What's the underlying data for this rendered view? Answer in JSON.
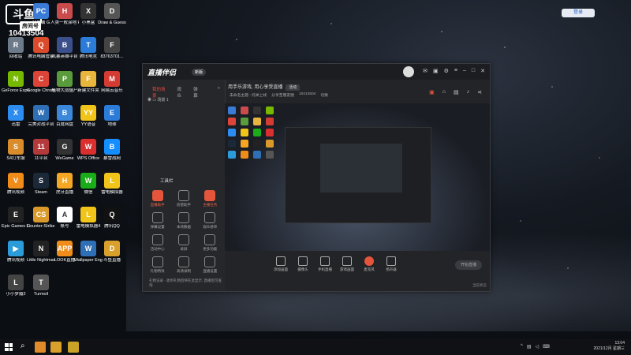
{
  "desktop": {
    "badge": {
      "logo_text": "斗鱼",
      "room_label": "房间号",
      "room_id": "10413504"
    },
    "top_right_button": "登录",
    "icons": [
      {
        "label": "此电脑 G",
        "color": "#3a7bd5",
        "glyph": "PC"
      },
      {
        "label": "人类一败涂地 Human Fa...",
        "color": "#c94b4b",
        "glyph": "H"
      },
      {
        "label": "小黑盒",
        "color": "#333",
        "glyph": "X"
      },
      {
        "label": "Draw & Guess",
        "color": "#555",
        "glyph": "D"
      },
      {
        "label": "回收站",
        "color": "#6c7a89",
        "glyph": "R"
      },
      {
        "label": "腾讯电脑管家",
        "color": "#d94b2b",
        "glyph": "Q"
      },
      {
        "label": "风暴英雄平台",
        "color": "#3b4f8a",
        "glyph": "B"
      },
      {
        "label": "腾讯电竞",
        "color": "#2b7bd9",
        "glyph": "T"
      },
      {
        "label": "83763701...",
        "color": "#444",
        "glyph": "F"
      },
      {
        "label": "GeForce Experience",
        "color": "#76b900",
        "glyph": "N"
      },
      {
        "label": "Google Chrome",
        "color": "#db4437",
        "glyph": "C"
      },
      {
        "label": "植物大战僵尸",
        "color": "#5a9c3b",
        "glyph": "P"
      },
      {
        "label": "新建文件夹",
        "color": "#e8b63c",
        "glyph": "F"
      },
      {
        "label": "网易云音乐",
        "color": "#d43c33",
        "glyph": "M"
      },
      {
        "label": "迅雷",
        "color": "#2d8cf0",
        "glyph": "X"
      },
      {
        "label": "完美对战平台",
        "color": "#2f6fb5",
        "glyph": "W"
      },
      {
        "label": "百度网盘",
        "color": "#3b87d9",
        "glyph": "B"
      },
      {
        "label": "YY语音",
        "color": "#f0c419",
        "glyph": "YY"
      },
      {
        "label": "地球",
        "color": "#2b7bd9",
        "glyph": "E"
      },
      {
        "label": "S4打车服",
        "color": "#d98c2b",
        "glyph": "S"
      },
      {
        "label": "11平台",
        "color": "#b33a3a",
        "glyph": "11"
      },
      {
        "label": "WeGame",
        "color": "#333",
        "glyph": "G"
      },
      {
        "label": "WPS Office",
        "color": "#d9302f",
        "glyph": "W"
      },
      {
        "label": "暴雪战网",
        "color": "#148eff",
        "glyph": "B"
      },
      {
        "label": "腾讯视频",
        "color": "#f08c1a",
        "glyph": "V"
      },
      {
        "label": "Steam",
        "color": "#1b2838",
        "glyph": "S"
      },
      {
        "label": "虎牙直播",
        "color": "#f5a623",
        "glyph": "H"
      },
      {
        "label": "微信",
        "color": "#1aad19",
        "glyph": "W"
      },
      {
        "label": "雷电模拟器",
        "color": "#f0c419",
        "glyph": "L"
      },
      {
        "label": "Epic Games Launcher",
        "color": "#222",
        "glyph": "E"
      },
      {
        "label": "Counter-Strike Global Off...",
        "color": "#d99a2b",
        "glyph": "CS"
      },
      {
        "label": "账号",
        "color": "#fff",
        "glyph": "A"
      },
      {
        "label": "雷电模拟器4",
        "color": "#f0c419",
        "glyph": "L"
      },
      {
        "label": "腾讯QQ",
        "color": "#111",
        "glyph": "Q"
      },
      {
        "label": "腾讯视频",
        "color": "#2b9cd9",
        "glyph": "▶"
      },
      {
        "label": "Little Nightmares",
        "color": "#222",
        "glyph": "N"
      },
      {
        "label": "LOOK直播",
        "color": "#f08c1a",
        "glyph": "APP"
      },
      {
        "label": "Wallpaper Engine",
        "color": "#2f6fb5",
        "glyph": "W"
      },
      {
        "label": "斗鱼直播",
        "color": "#d9a02b",
        "glyph": "D"
      },
      {
        "label": "小小梦魇2",
        "color": "#444",
        "glyph": "L"
      },
      {
        "label": "Turmoil",
        "color": "#555",
        "glyph": "T"
      }
    ]
  },
  "app": {
    "title": "直播伴侣",
    "version": "新版",
    "tabs": [
      "我的场景",
      "观众",
      "弹幕"
    ],
    "scene_item": "场景 1",
    "notice_text": "用手乐游戏, 用心享受直播",
    "notice_tag": "活动",
    "meta": [
      "未命名主题 : 托举上线",
      "分享至朋友圈",
      "10413504",
      "切换"
    ],
    "tools_title": "工具栏",
    "tools": [
      {
        "label": "直播助手",
        "red": true
      },
      {
        "label": "房管助手",
        "red": false
      },
      {
        "label": "主播任务",
        "red": true
      },
      {
        "label": "弹幕设置",
        "red": false
      },
      {
        "label": "本场数据",
        "red": false
      },
      {
        "label": "观众榜单",
        "red": false
      },
      {
        "label": "活动中心",
        "red": false
      },
      {
        "label": "录屏",
        "red": false
      },
      {
        "label": "更多功能",
        "red": false
      },
      {
        "label": "礼物特效",
        "red": false
      },
      {
        "label": "高清录制",
        "red": false
      },
      {
        "label": "直播设置",
        "red": false
      }
    ],
    "bottom_note": "礼物记录 · 收到礼物后将在此显示, 直播后可查询",
    "controls": [
      {
        "label": "添加画面",
        "red": false
      },
      {
        "label": "摄像头",
        "red": false
      },
      {
        "label": "手机直播",
        "red": false
      },
      {
        "label": "游戏画面",
        "red": false
      },
      {
        "label": "麦克风",
        "red": true
      },
      {
        "label": "扬声器",
        "red": false
      }
    ],
    "start_button": "开始直播",
    "status": "当前状态"
  },
  "taskbar": {
    "time": "13:04",
    "date": "2021/12月 星期三"
  }
}
